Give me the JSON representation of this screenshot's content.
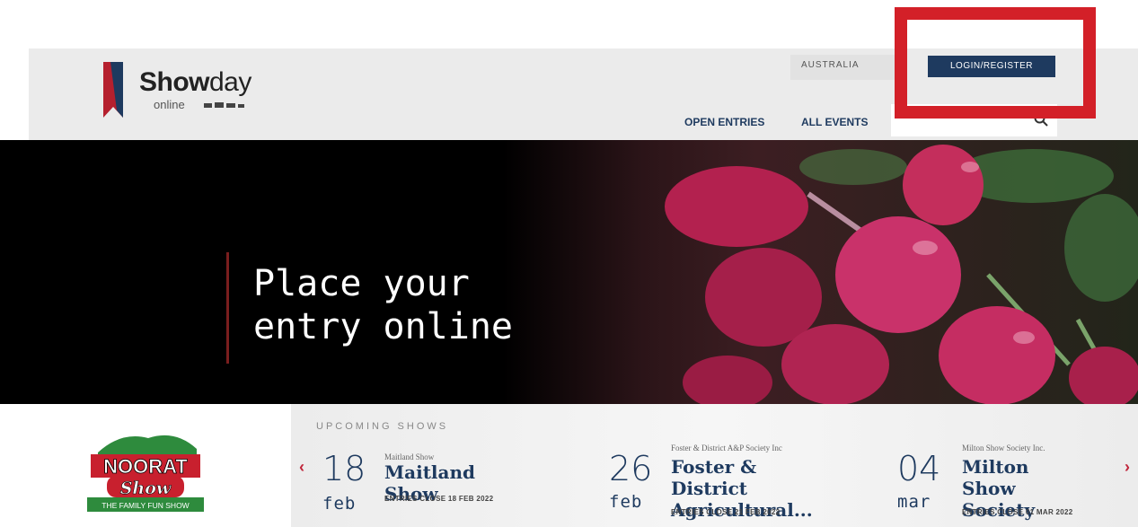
{
  "brand": {
    "name_bold": "Show",
    "name_light": "day",
    "subtitle": "online",
    "colors": {
      "navy": "#1e3a5f",
      "red": "#c0263b",
      "annotation": "#d32028"
    }
  },
  "header": {
    "country_label": "AUSTRALIA",
    "login_label": "LOGIN/REGISTER",
    "nav": {
      "open_entries": "OPEN ENTRIES",
      "all_events": "ALL EVENTS"
    },
    "search_placeholder": ""
  },
  "hero": {
    "line1": "Place your",
    "line2": "entry online"
  },
  "sponsor": {
    "line1": "NOORAT",
    "line2": "Show",
    "tagline": "THE FAMILY FUN SHOW"
  },
  "upcoming": {
    "label": "UPCOMING SHOWS",
    "prev_icon": "‹",
    "next_icon": "›",
    "shows": [
      {
        "day": "18",
        "month": "feb",
        "org": "Maitland Show",
        "title": "Maitland Show",
        "title2": "",
        "closes": "ENTRIES CLOSE 18 FEB 2022"
      },
      {
        "day": "26",
        "month": "feb",
        "org": "Foster & District A&P Society Inc",
        "title": "Foster & District",
        "title2": "Agricultural...",
        "closes": "ENTRIES CLOSE 21 FEB 2022"
      },
      {
        "day": "04",
        "month": "mar",
        "org": "Milton Show Society Inc.",
        "title": "Milton Show",
        "title2": "Society",
        "closes": "ENTRIES CLOSE 01 MAR 2022"
      }
    ]
  }
}
